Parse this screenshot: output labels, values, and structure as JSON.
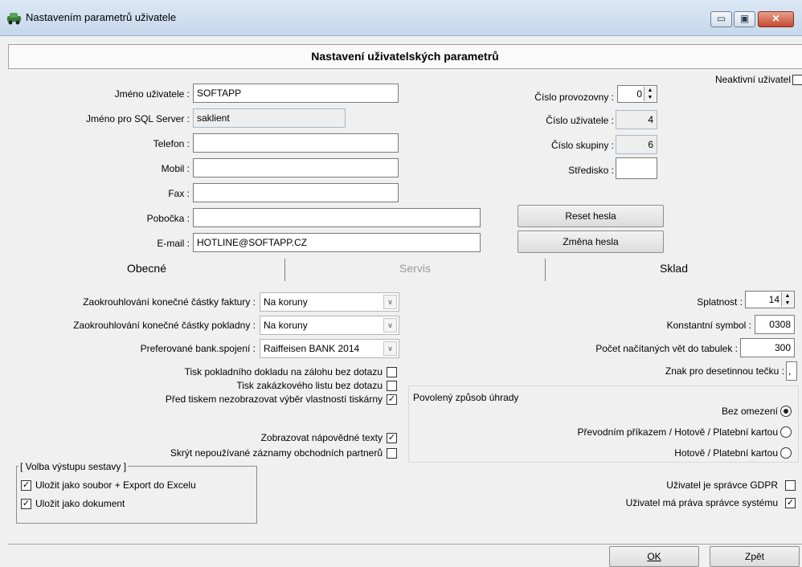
{
  "window": {
    "title": "Nastavením parametrů uživatele",
    "minimize": "▭",
    "restore": "▣",
    "close": "✕"
  },
  "header": {
    "title": "Nastavení uživatelských parametrů"
  },
  "inactive": {
    "label": "Neaktivní uživatel",
    "checked": false
  },
  "user": {
    "name_label": "Jméno uživatele :",
    "name_value": "SOFTAPP",
    "sql_label": "Jméno pro SQL Server :",
    "sql_value": "saklient",
    "phone_label": "Telefon :",
    "phone_value": "",
    "mobile_label": "Mobil :",
    "mobile_value": "",
    "fax_label": "Fax :",
    "fax_value": "",
    "branch_label": "Pobočka :",
    "branch_value": "",
    "email_label": "E-mail :",
    "email_value": "HOTLINE@SOFTAPP.CZ"
  },
  "right_info": {
    "plant_label": "Číslo provozovny :",
    "plant_value": "0",
    "userno_label": "Číslo uživatele :",
    "userno_value": "4",
    "groupno_label": "Číslo skupiny :",
    "groupno_value": "6",
    "center_label": "Středisko :",
    "center_value": ""
  },
  "buttons": {
    "reset_password": "Reset hesla",
    "change_password": "Změna hesla",
    "ok": "OK",
    "cancel": "Zpět"
  },
  "tabs": [
    "Obecné",
    "Servis",
    "Sklad"
  ],
  "rounding": {
    "invoice_label": "Zaokrouhlování konečné částky faktury :",
    "invoice_value": "Na koruny",
    "cash_label": "Zaokrouhlování konečné částky pokladny :",
    "cash_value": "Na koruny",
    "bank_label": "Preferované bank.spojení :",
    "bank_value": "Raiffeisen BANK 2014"
  },
  "options": {
    "cash_doc": {
      "label": "Tisk pokladního dokladu na zálohu bez dotazu",
      "checked": false
    },
    "order_sheet": {
      "label": "Tisk zakázkového listu bez dotazu",
      "checked": false
    },
    "printer_dialog": {
      "label": "Před tiskem nezobrazovat výběr vlastností tiskárny",
      "checked": true
    },
    "hints": {
      "label": "Zobrazovat nápovědné texty",
      "checked": true
    },
    "hide_partners": {
      "label": "Skrýt nepoužívané záznamy obchodních partnerů",
      "checked": false
    }
  },
  "output_group": {
    "title": "[ Volba výstupu sestavy ]",
    "save_file": {
      "label": "Uložit jako soubor + Export do Excelu",
      "checked": true
    },
    "save_doc": {
      "label": "Uložit jako dokument",
      "checked": true
    }
  },
  "right_params": {
    "due_label": "Splatnost :",
    "due_value": "14",
    "const_label": "Konstantní symbol :",
    "const_value": "0308",
    "rows_label": "Počet načítaných vět do tabulek :",
    "rows_value": "300",
    "decimal_label": "Znak pro desetinnou tečku :",
    "decimal_value": ","
  },
  "payment": {
    "title": "Povolený způsob úhrady",
    "options": [
      {
        "label": "Bez omezení",
        "selected": true
      },
      {
        "label": "Převodním příkazem / Hotově / Platební kartou",
        "selected": false
      },
      {
        "label": "Hotově / Platební kartou",
        "selected": false
      }
    ]
  },
  "admin": {
    "gdpr": {
      "label": "Uživatel je správce GDPR",
      "checked": false
    },
    "sysadmin": {
      "label": "Uživatel má práva správce systému",
      "checked": true
    }
  },
  "colors": {
    "titlebar": "#c6d8ec",
    "close_button": "#c44a2e",
    "disabled_tab": "#9a9a9a"
  }
}
